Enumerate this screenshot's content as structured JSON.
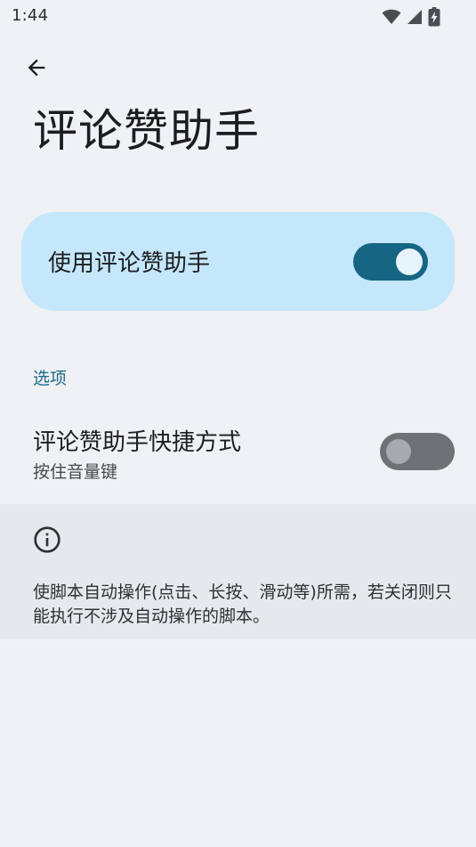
{
  "status_bar": {
    "time": "1:44",
    "icons": [
      "wifi-icon",
      "signal-icon",
      "battery-charging-icon"
    ]
  },
  "app_bar": {
    "back_icon": "arrow-back-icon",
    "title": "评论赞助手"
  },
  "main_toggle": {
    "label": "使用评论赞助手",
    "checked": true
  },
  "options_section": {
    "header": "选项",
    "shortcut": {
      "title": "评论赞助手快捷方式",
      "subtitle": "按住音量键",
      "checked": false
    }
  },
  "info": {
    "icon": "info-icon",
    "text": "使脚本自动操作(点击、长按、滑动等)所需，若关闭则只能执行不涉及自动操作的脚本。"
  },
  "colors": {
    "background": "#eff1f4",
    "card": "#c4e7fb",
    "accent": "#156583",
    "section_header": "#1d6a8c",
    "info_panel": "#e6e8eb"
  }
}
